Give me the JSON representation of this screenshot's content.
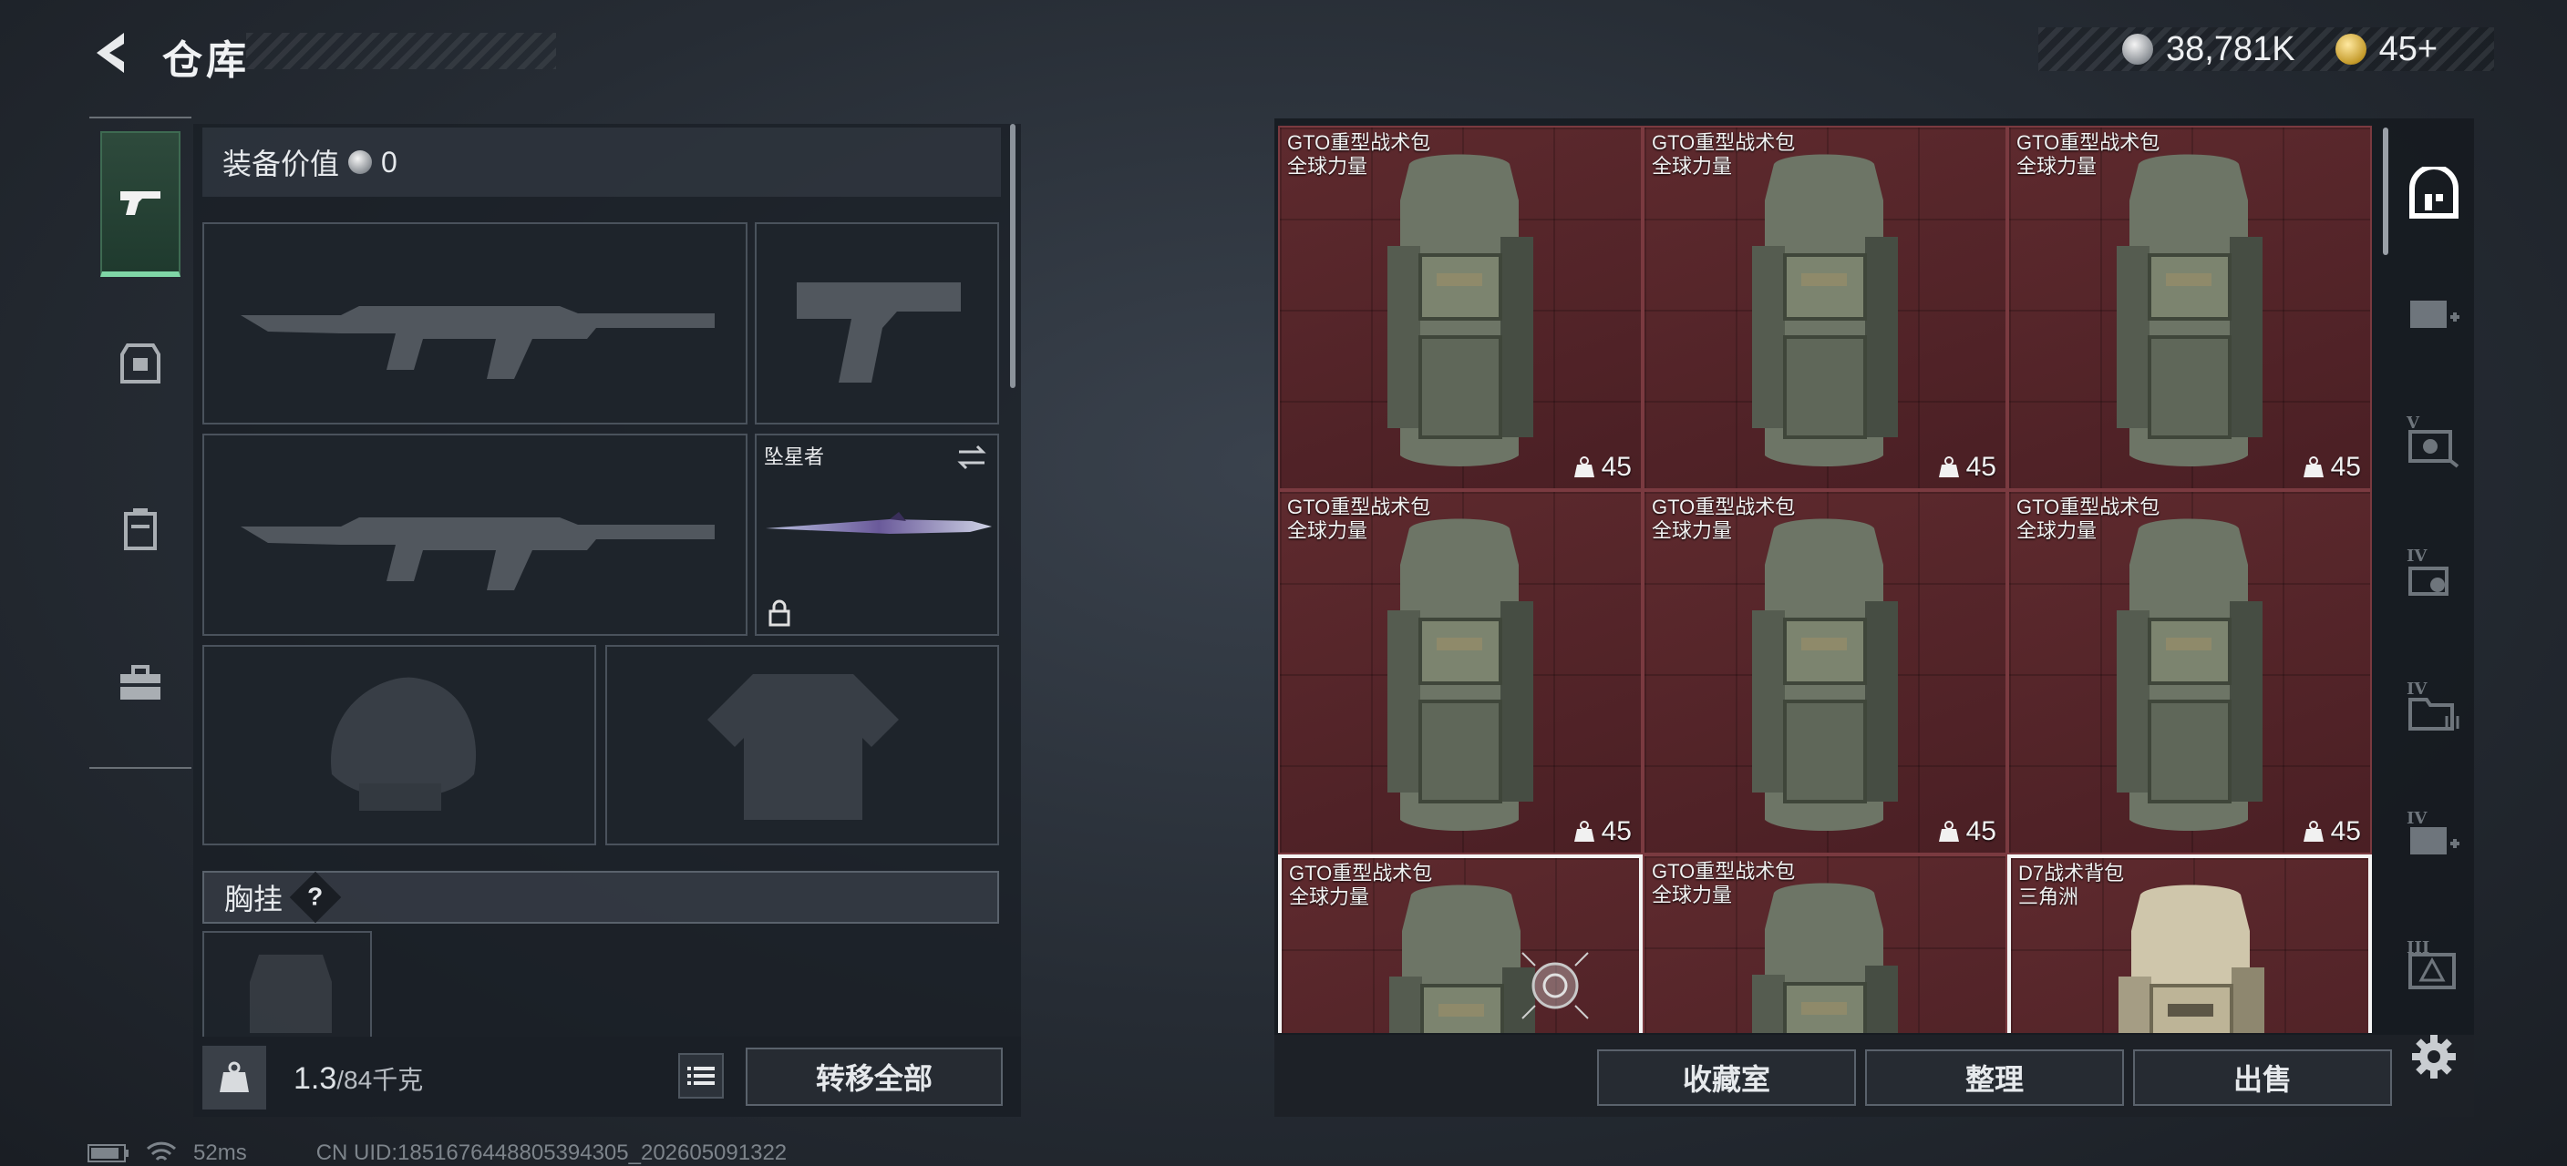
{
  "header": {
    "title": "仓库"
  },
  "currency": {
    "silver": "38,781K",
    "gold": "45+"
  },
  "equipment": {
    "value_label": "装备价值",
    "value": "0",
    "melee_name": "坠星者",
    "chest_label": "胸挂",
    "chest_help": "?"
  },
  "capacity": {
    "current": "1.3",
    "max": "/84千克",
    "transfer_label": "转移全部"
  },
  "storage": {
    "items": [
      {
        "name": "GTO重型战术包\n全球力量",
        "count": "45"
      },
      {
        "name": "GTO重型战术包\n全球力量",
        "count": "45"
      },
      {
        "name": "GTO重型战术包\n全球力量",
        "count": "45"
      },
      {
        "name": "GTO重型战术包\n全球力量",
        "count": "45"
      },
      {
        "name": "GTO重型战术包\n全球力量",
        "count": "45"
      },
      {
        "name": "GTO重型战术包\n全球力量",
        "count": "45"
      },
      {
        "name": "GTO重型战术包\n全球力量",
        "count": ""
      },
      {
        "name": "GTO重型战术包\n全球力量",
        "count": ""
      },
      {
        "name": "D7战术背包\n三角洲",
        "count": ""
      }
    ],
    "buttons": {
      "collection": "收藏室",
      "sort": "整理",
      "sell": "出售"
    },
    "tab_levels": [
      "",
      "",
      "V",
      "IV",
      "IV",
      "IV",
      "III"
    ]
  },
  "status": {
    "ping": "52ms",
    "uid": "CN UID:1851676448805394305_202605091322"
  },
  "colors": {
    "accent": "#7fd6a6",
    "cell_bg": "#5e2a2e"
  }
}
